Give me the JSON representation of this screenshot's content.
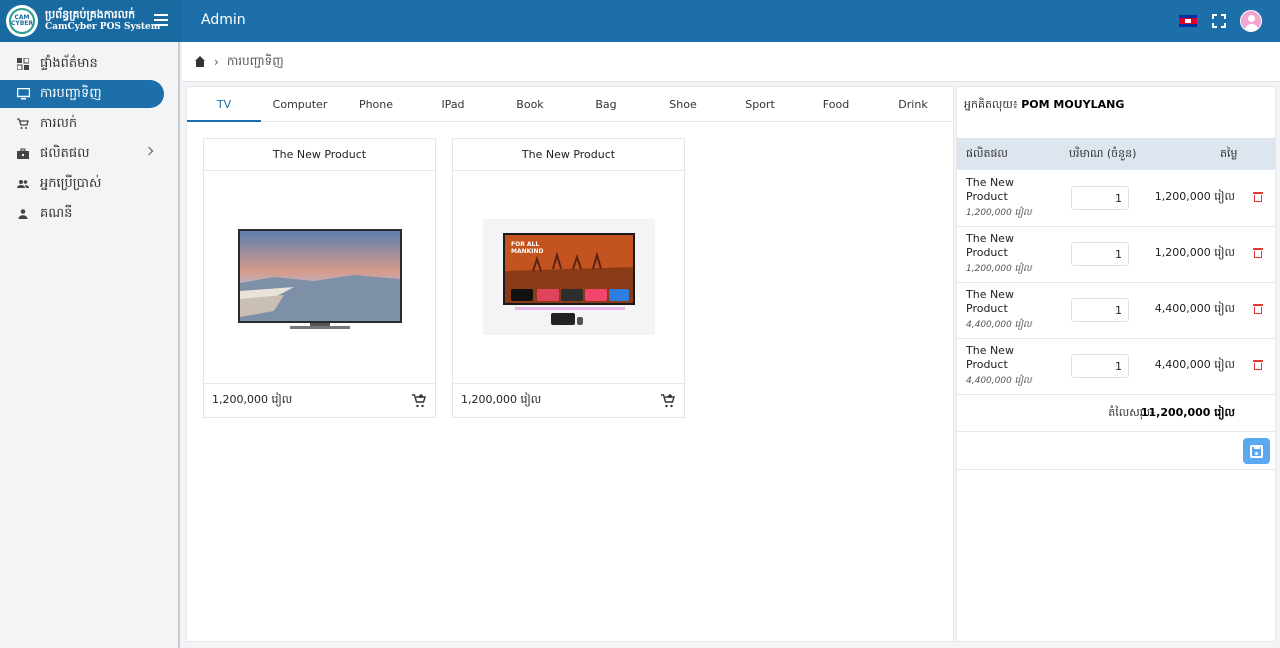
{
  "brand": {
    "title_kh": "ប្រព័ន្ធគ្រប់គ្រងការលក់",
    "title_en": "CamCyber POS System",
    "logo_text": "CAM CYBER"
  },
  "header": {
    "title": "Admin"
  },
  "sidebar": {
    "items": [
      {
        "label": "ផ្ទាំងព័ត៌មាន",
        "icon": "dashboard-icon"
      },
      {
        "label": "ការបញ្ជាទិញ",
        "icon": "monitor-icon",
        "active": true
      },
      {
        "label": "ការលក់",
        "icon": "cart-icon"
      },
      {
        "label": "ផលិតផល",
        "icon": "briefcase-icon"
      },
      {
        "label": "អ្នកប្រើប្រាស់",
        "icon": "users-icon"
      },
      {
        "label": "គណនី",
        "icon": "user-icon"
      }
    ]
  },
  "breadcrumb": {
    "current": "ការបញ្ជាទិញ"
  },
  "tabs": [
    "TV",
    "Computer",
    "Phone",
    "IPad",
    "Book",
    "Bag",
    "Shoe",
    "Sport",
    "Food",
    "Drink"
  ],
  "products": [
    {
      "title": "The New Product",
      "price": "1,200,000 រៀល"
    },
    {
      "title": "The New Product",
      "price": "1,200,000 រៀល"
    }
  ],
  "cart": {
    "customer_label": "អ្នកគិតលុយ៖",
    "customer_name": "POM MOUYLANG",
    "headers": {
      "product": "ផលិតផល",
      "qty": "បរិមាណ (ចំនួន)",
      "price": "តម្លៃ"
    },
    "rows": [
      {
        "name": "The New Product",
        "unit_price": "1,200,000 រៀល",
        "qty": "1",
        "price": "1,200,000 រៀល"
      },
      {
        "name": "The New Product",
        "unit_price": "1,200,000 រៀល",
        "qty": "1",
        "price": "1,200,000 រៀល"
      },
      {
        "name": "The New Product",
        "unit_price": "4,400,000 រៀល",
        "qty": "1",
        "price": "4,400,000 រៀល"
      },
      {
        "name": "The New Product",
        "unit_price": "4,400,000 រៀល",
        "qty": "1",
        "price": "4,400,000 រៀល"
      }
    ],
    "total_label": "តំលៃសរុប៖",
    "total_value": "11,200,000 រៀល"
  },
  "colors": {
    "primary": "#1c6fa8",
    "danger": "#e53935",
    "save": "#5aa9f0"
  }
}
